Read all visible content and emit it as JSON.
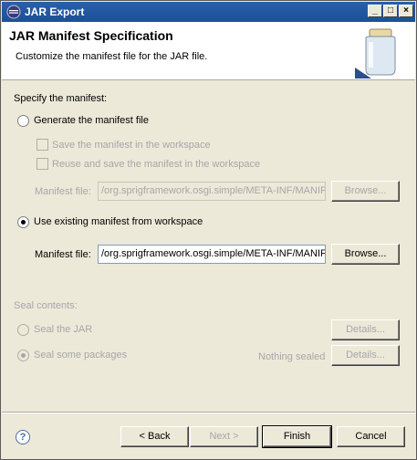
{
  "window": {
    "title": "JAR Export",
    "minimize_glyph": "_",
    "maximize_glyph": "□",
    "close_glyph": "×"
  },
  "banner": {
    "heading": "JAR Manifest Specification",
    "description": "Customize the manifest file for the JAR file."
  },
  "manifest": {
    "section_label": "Specify the manifest:",
    "generate_label": "Generate the manifest file",
    "generate_selected": false,
    "save_label": "Save the manifest in the workspace",
    "reuse_label": "Reuse and save the manifest in the workspace",
    "generated_field_label": "Manifest file:",
    "generated_field_value": "/org.sprigframework.osgi.simple/META-INF/MANIF",
    "generated_browse_label": "Browse...",
    "use_existing_label": "Use existing manifest from workspace",
    "use_existing_selected": true,
    "existing_field_label": "Manifest file:",
    "existing_field_value": "/org.sprigframework.osgi.simple/META-INF/MANIF",
    "existing_browse_label": "Browse..."
  },
  "seal": {
    "section_label": "Seal contents:",
    "seal_jar_label": "Seal the JAR",
    "seal_jar_details": "Details...",
    "seal_packages_label": "Seal some packages",
    "seal_packages_status": "Nothing sealed",
    "seal_packages_details": "Details..."
  },
  "footer": {
    "help_glyph": "?",
    "back_label": "< Back",
    "next_label": "Next >",
    "finish_label": "Finish",
    "cancel_label": "Cancel"
  }
}
